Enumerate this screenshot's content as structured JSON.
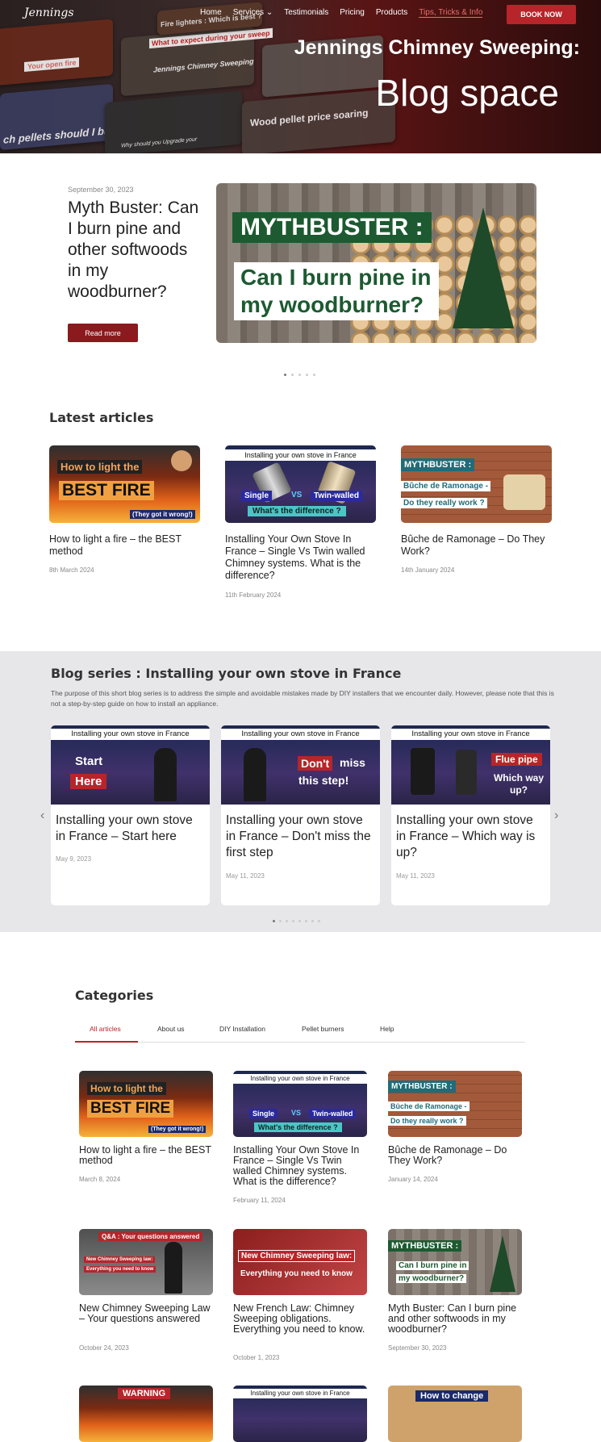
{
  "header": {
    "logo": "Jennings",
    "nav": [
      "Home",
      "Services",
      "Testimonials",
      "Pricing",
      "Products",
      "Tips, Tricks & Info"
    ],
    "active_nav": "Tips, Tricks & Info",
    "book_label": "BOOK NOW",
    "title_line1": "Jennings Chimney Sweeping:",
    "title_line2": "Blog space",
    "collage_text": [
      "Fire lighters : Which is best ?",
      "What to expect during your sweep",
      "Jennings Chimney Sweeping",
      "Your open fire",
      "Wood pellet price soaring",
      "ch pellets should I buy?",
      "Why should you Upgrade your"
    ]
  },
  "featured": {
    "date": "September 30, 2023",
    "title": "Myth Buster: Can I burn pine and other softwoods in my woodburner?",
    "button": "Read more",
    "image_text1": "MYTHBUSTER :",
    "image_text2": "Can I burn pine in my woodburner?"
  },
  "latest": {
    "heading": "Latest articles",
    "articles": [
      {
        "title": "How to light a fire – the BEST method",
        "date": "8th March 2024",
        "img": [
          "How to light the",
          "BEST FIRE",
          "(They got it wrong!)"
        ]
      },
      {
        "title": "Installing Your Own Stove In France – Single Vs Twin walled Chimney systems. What is the difference?",
        "date": "11th February 2024",
        "img": [
          "Installing your own stove in France",
          "Single",
          "VS",
          "Twin-walled",
          "What's the difference ?"
        ]
      },
      {
        "title": "Bûche de Ramonage – Do They Work?",
        "date": "14th January 2024",
        "img": [
          "MYTHBUSTER :",
          "Bûche de Ramonage -",
          "Do they really work ?"
        ]
      }
    ]
  },
  "series": {
    "heading": "Blog series : Installing your own stove in France",
    "desc": "The purpose of this short blog series is to address the simple and avoidable mistakes made by DIY installers that we encounter daily. However, please note that this is not a step-by-step guide on how to install an appliance.",
    "band": "Installing your own stove in France",
    "cards": [
      {
        "title": "Installing your own stove in France – Start here",
        "date": "May 9, 2023",
        "img": [
          "Start",
          "Here"
        ]
      },
      {
        "title": "Installing your own stove in France – Don't miss the first step",
        "date": "May 11, 2023",
        "img": [
          "Don't",
          "miss",
          "this step!"
        ]
      },
      {
        "title": "Installing your own stove in France – Which way is up?",
        "date": "May 11, 2023",
        "img": [
          "Flue pipe",
          "Which way up?"
        ]
      }
    ],
    "prev": "‹",
    "next": "›"
  },
  "categories": {
    "heading": "Categories",
    "tabs": [
      "All articles",
      "About us",
      "DIY Installation",
      "Pellet burners",
      "Help"
    ],
    "active_tab": "All articles",
    "posts": [
      {
        "title": "How to light a fire – the BEST method",
        "date": "March 8, 2024"
      },
      {
        "title": "Installing Your Own Stove In France – Single Vs Twin walled Chimney systems. What is the difference?",
        "date": "February 11, 2024"
      },
      {
        "title": "Bûche de Ramonage – Do They Work?",
        "date": "January 14, 2024"
      },
      {
        "title": "New Chimney Sweeping Law – Your questions answered",
        "date": "October 24, 2023",
        "img": [
          "Q&A : Your questions answered",
          "New Chimney Sweeping law:",
          "Everything you need to know"
        ]
      },
      {
        "title": "New French Law: Chimney Sweeping obligations. Everything you need to know.",
        "date": "October 1, 2023",
        "img": [
          "New Chimney Sweeping law:",
          "Everything you need to know"
        ]
      },
      {
        "title": "Myth Buster: Can I burn pine and other softwoods in my woodburner?",
        "date": "September 30, 2023",
        "img": [
          "MYTHBUSTER :",
          "Can I burn pine in",
          "my woodburner?"
        ]
      }
    ],
    "row3_img": [
      "WARNING",
      "Installing your own stove in France",
      "How to change"
    ]
  },
  "colors": {
    "accent": "#b7252a",
    "hero_dark": "#2b0c0c",
    "section_grey": "#e7e7ea",
    "myth_green": "#1d5a31"
  }
}
